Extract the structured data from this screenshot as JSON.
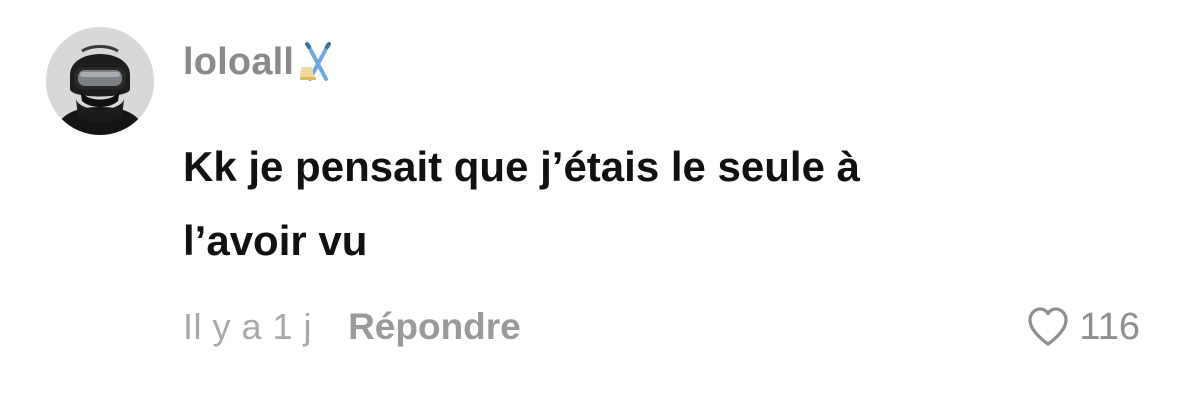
{
  "comment": {
    "username": "loloall",
    "text_lines": [
      "Kk je pensait que j’étais le seule à",
      "l’avoir vu"
    ],
    "timestamp": "Il y a 1 j",
    "reply_label": "Répondre",
    "like_count": "116"
  },
  "icons": {
    "avatar": "helmet-goggles-avatar",
    "badge": "ski-icon",
    "like": "heart-outline-icon"
  },
  "colors": {
    "username": "#8a8a8a",
    "text": "#111111",
    "meta": "#a9a9a9",
    "reply": "#9a9a9a",
    "heart": "#8f8f8f"
  }
}
